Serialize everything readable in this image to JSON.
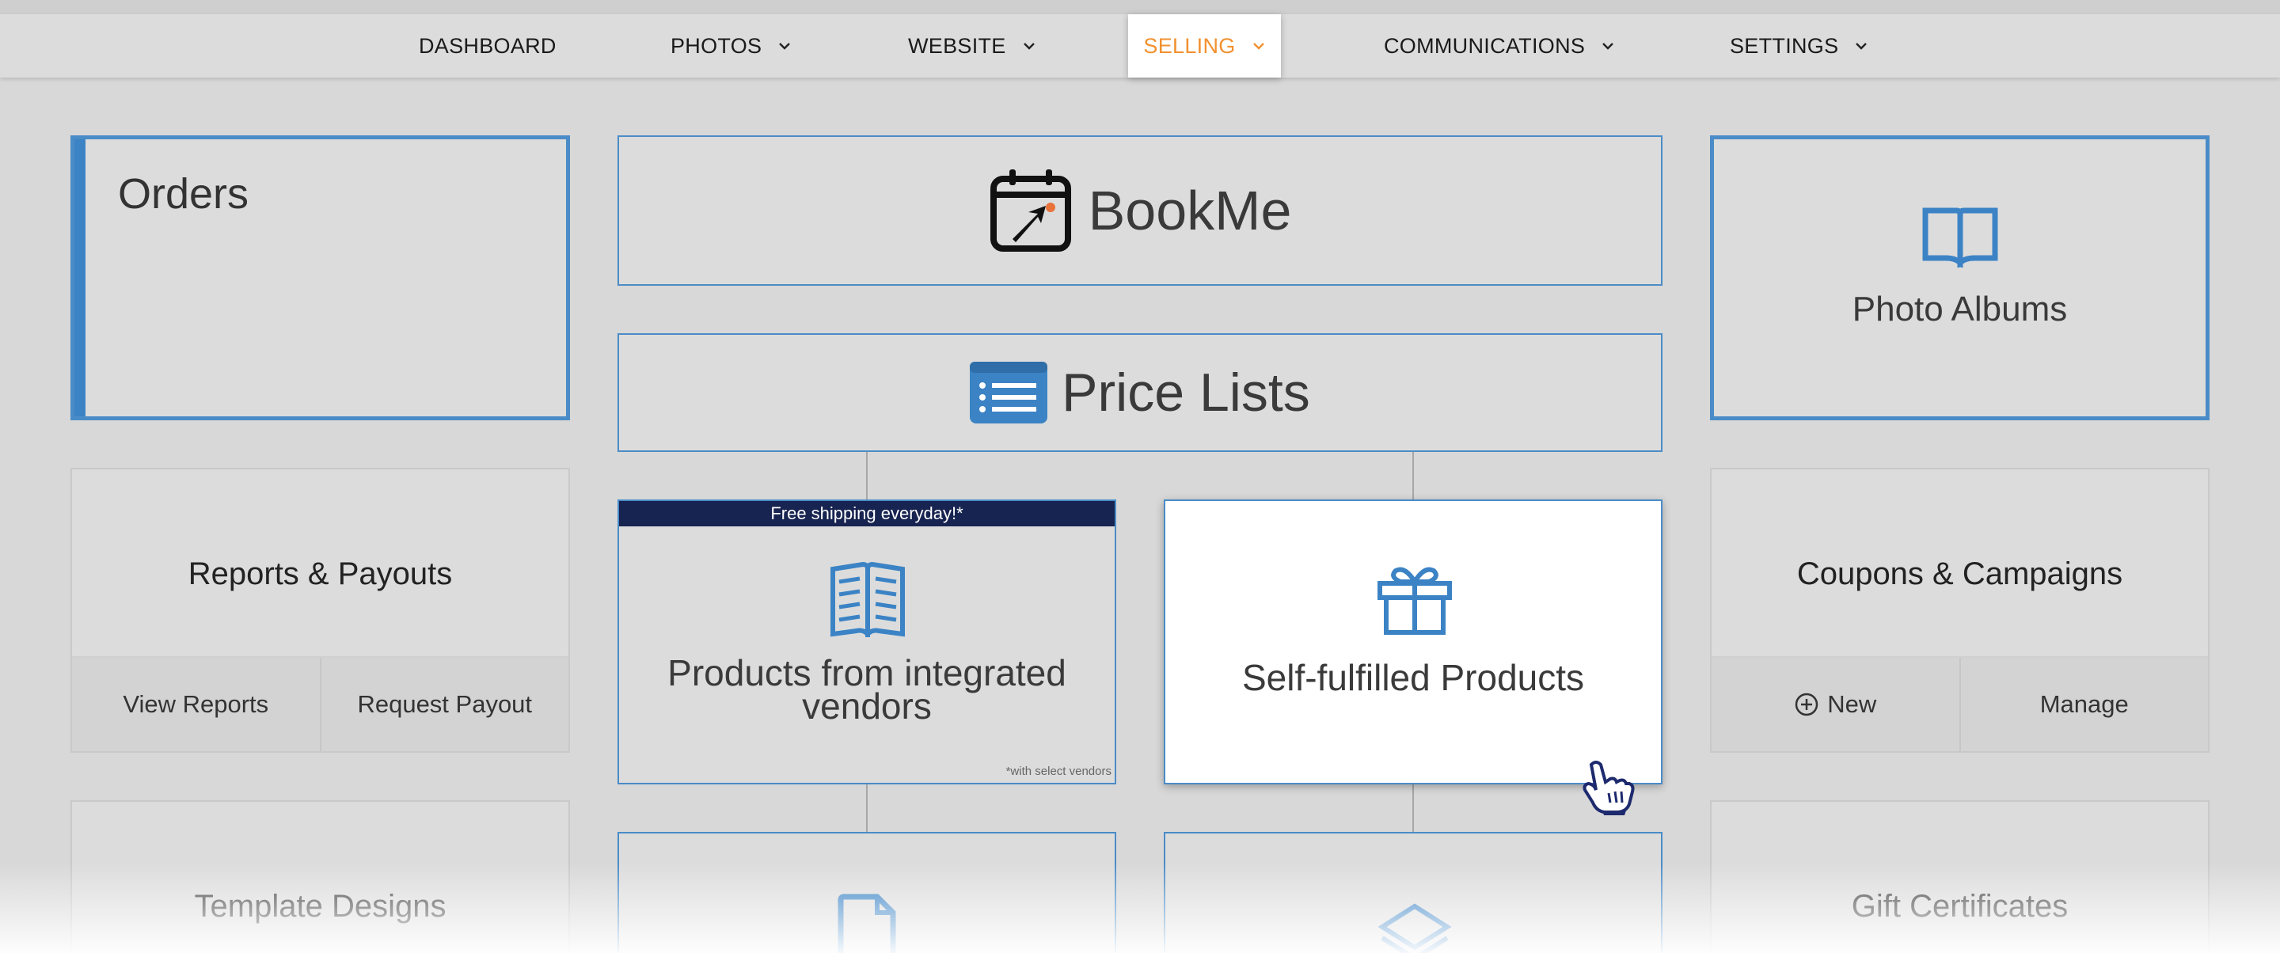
{
  "nav": {
    "items": [
      {
        "label": "DASHBOARD",
        "has_dropdown": false
      },
      {
        "label": "PHOTOS",
        "has_dropdown": true
      },
      {
        "label": "WEBSITE",
        "has_dropdown": true
      },
      {
        "label": "SELLING",
        "has_dropdown": true,
        "active": true
      },
      {
        "label": "COMMUNICATIONS",
        "has_dropdown": true
      },
      {
        "label": "SETTINGS",
        "has_dropdown": true
      }
    ],
    "active_color": "#f2912f"
  },
  "tiles": {
    "orders": {
      "title": "Orders"
    },
    "bookme": {
      "title": "BookMe",
      "icon": "calendar-cursor-icon"
    },
    "price_lists": {
      "title": "Price Lists",
      "icon": "list-card-icon"
    },
    "photo_albums": {
      "title": "Photo Albums",
      "icon": "open-book-icon"
    },
    "reports": {
      "title": "Reports & Payouts",
      "actions": [
        "View Reports",
        "Request Payout"
      ]
    },
    "integrated": {
      "banner": "Free shipping everyday!*",
      "title_line1": "Products from integrated",
      "title_line2": "vendors",
      "footnote": "*with select vendors",
      "icon": "catalog-icon"
    },
    "self_fulfilled": {
      "title": "Self-fulfilled Products",
      "icon": "gift-icon"
    },
    "coupons": {
      "title": "Coupons & Campaigns",
      "actions": [
        "New",
        "Manage"
      ],
      "new_icon": "plus-circle-icon"
    },
    "templates": {
      "title": "Template Designs"
    },
    "gift_certificates": {
      "title": "Gift Certificates"
    },
    "bottom_left_product": {
      "icon": "document-icon"
    },
    "bottom_right_product": {
      "icon": "layers-icon"
    }
  },
  "colors": {
    "accent": "#4a8cc7",
    "banner": "#172350",
    "icon": "#3b83c5"
  }
}
